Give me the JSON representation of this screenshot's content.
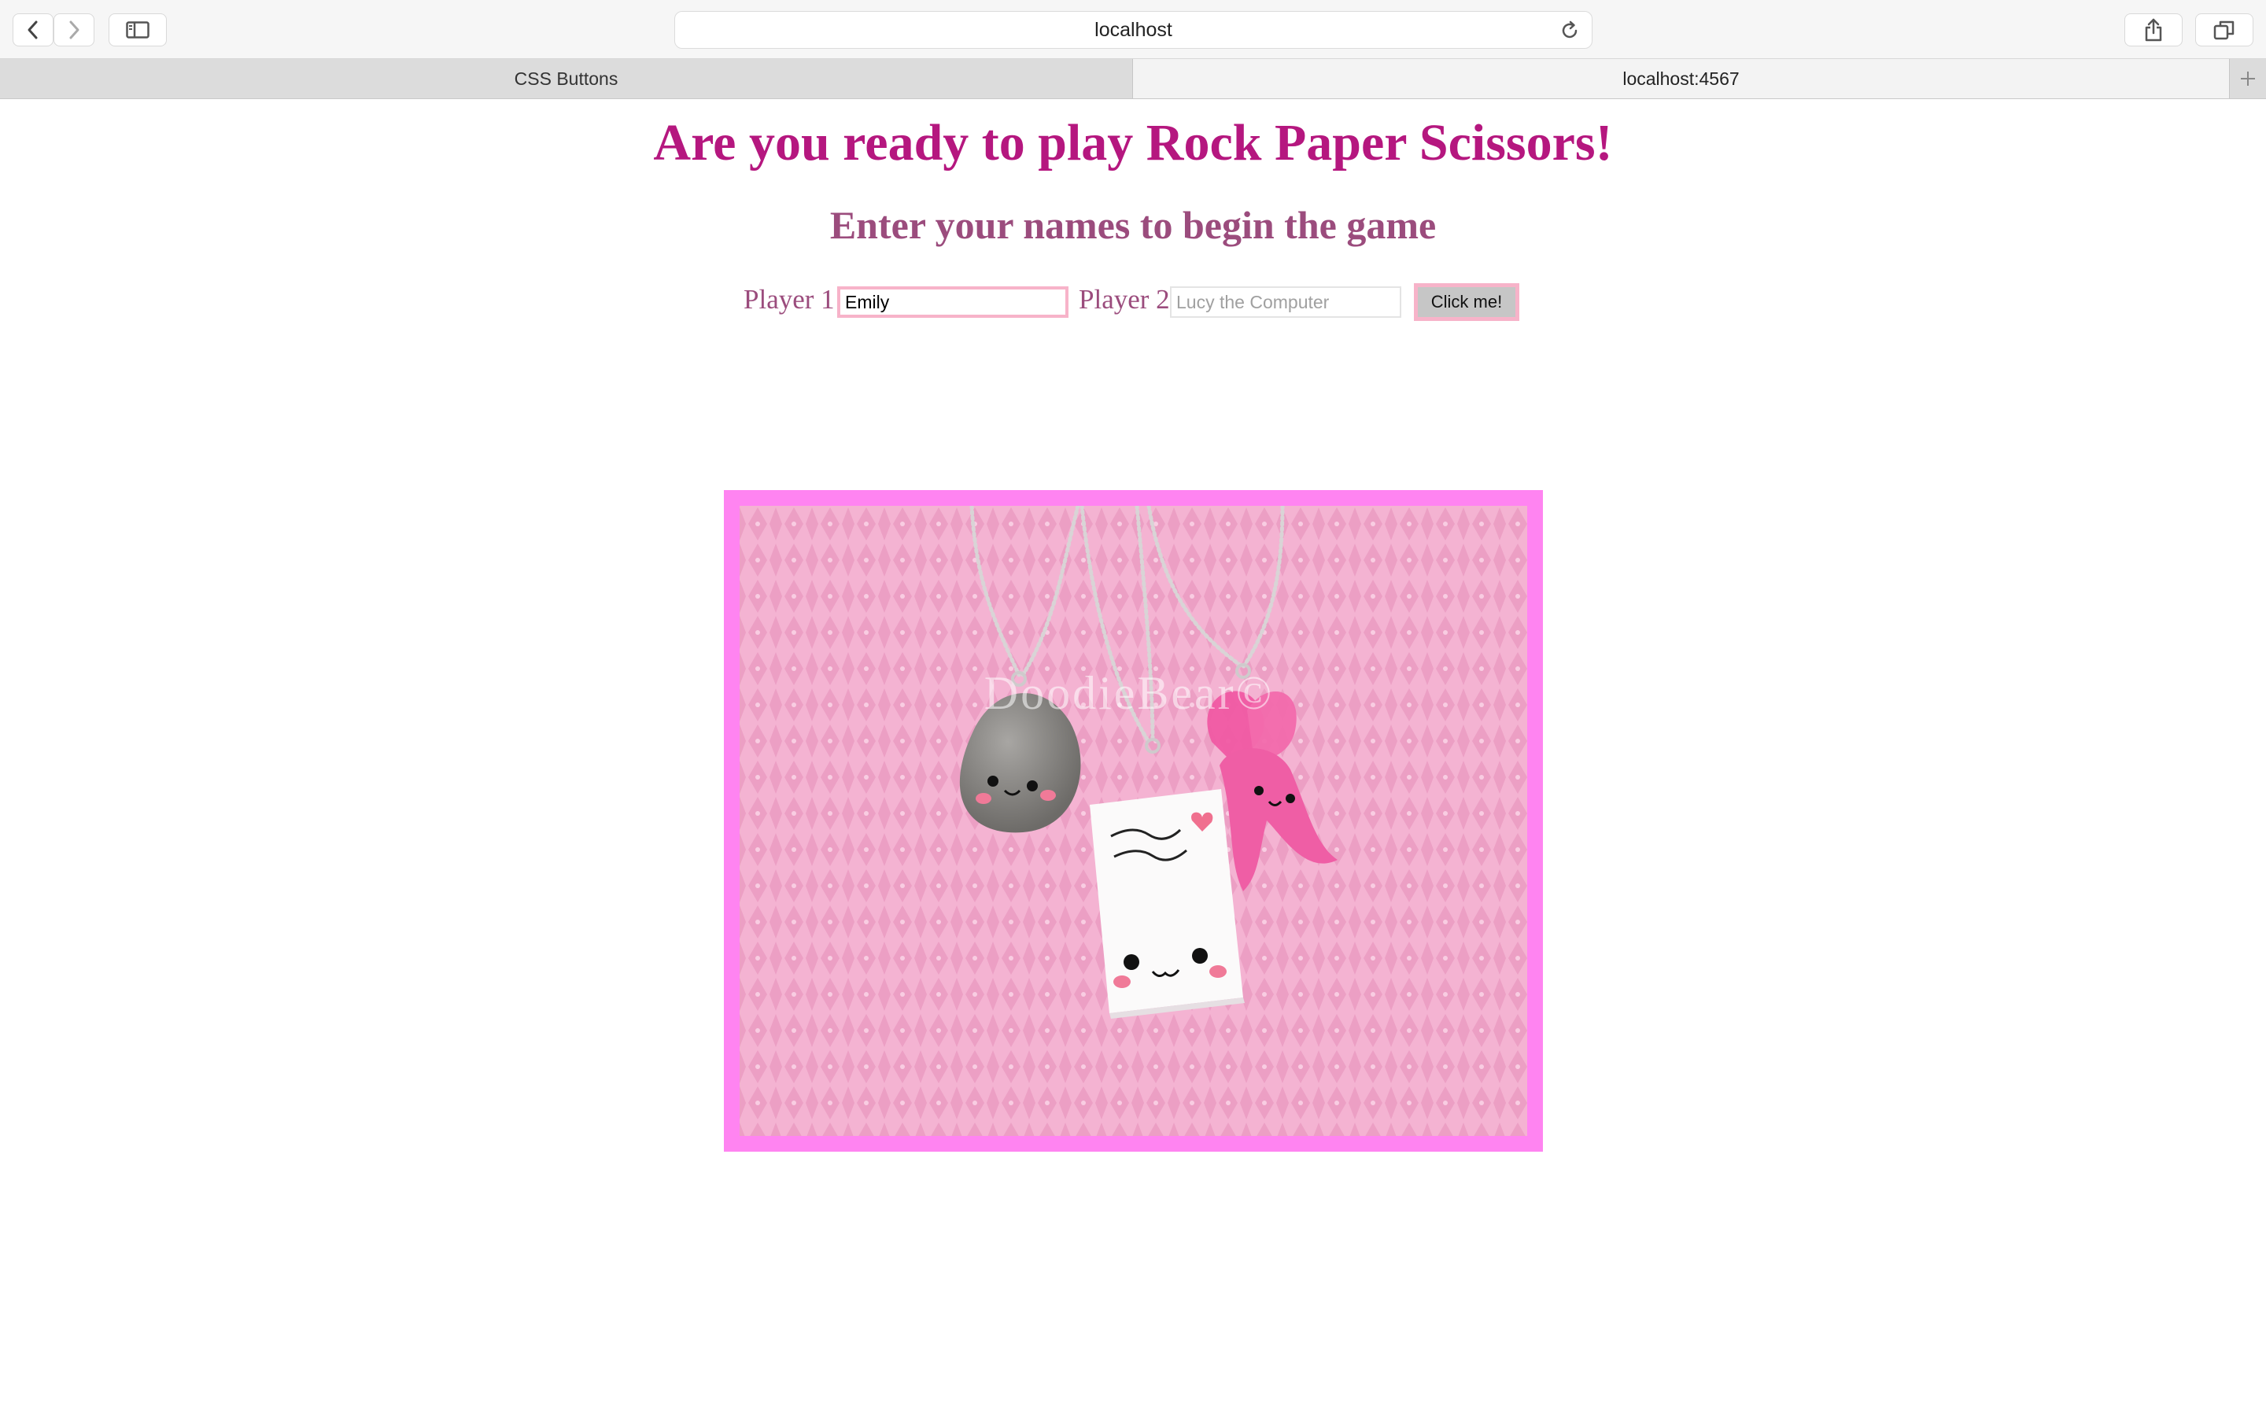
{
  "browser": {
    "url": "localhost",
    "tabs": [
      {
        "label": "CSS Buttons",
        "active": false
      },
      {
        "label": "localhost:4567",
        "active": true
      }
    ]
  },
  "page": {
    "heading": "Are you ready to play Rock Paper Scissors!",
    "subheading": "Enter your names to begin the game",
    "form": {
      "player1_label": "Player 1",
      "player1_value": "Emily",
      "player2_label": "Player 2",
      "player2_placeholder": "Lucy the Computer",
      "submit_label": "Click me!"
    },
    "image": {
      "watermark": "DoodieBear©"
    }
  },
  "colors": {
    "heading": "#b5177f",
    "subheading": "#9b4c7d",
    "frame": "#ff84f1",
    "input_border": "#f7b3c9"
  }
}
